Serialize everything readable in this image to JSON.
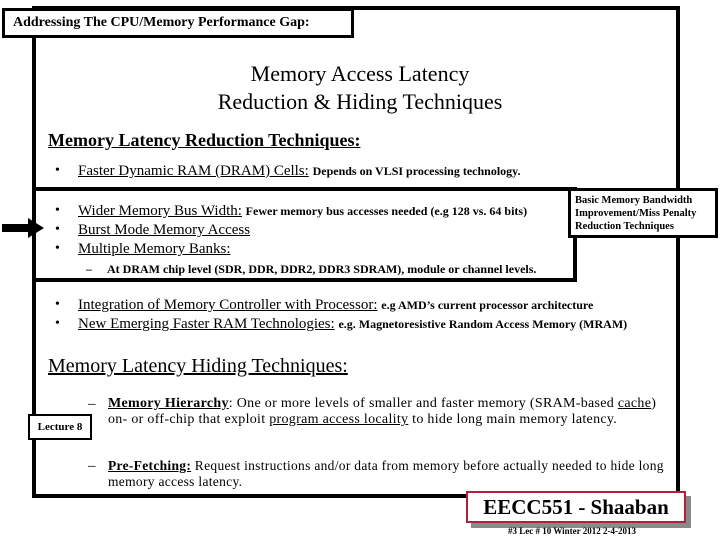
{
  "header": {
    "section_label": "Addressing The CPU/Memory Performance Gap:"
  },
  "title": {
    "line1": "Memory Access Latency",
    "line2": "Reduction & Hiding Techniques"
  },
  "reduction": {
    "heading": "Memory Latency Reduction Techniques:",
    "items": [
      {
        "bullet": "•",
        "label": "Faster Dynamic RAM (DRAM) Cells:",
        "note": "Depends on VLSI processing technology."
      },
      {
        "bullet": "•",
        "label": "Wider Memory Bus Width:",
        "note": "Fewer memory bus accesses needed  (e.g 128 vs. 64 bits)"
      },
      {
        "bullet": "•",
        "label": "Burst Mode Memory Access",
        "note": ""
      },
      {
        "bullet": "•",
        "label": "Multiple Memory Banks:",
        "note": ""
      },
      {
        "bullet": "•",
        "label": "Integration of Memory Controller with Processor:",
        "note": "e.g AMD’s current processor architecture"
      },
      {
        "bullet": "•",
        "label": "New Emerging Faster RAM Technologies:",
        "note": "e.g. Magnetoresistive Random Access Memory (MRAM)"
      }
    ],
    "sub_item": {
      "dash": "–",
      "text": "At DRAM chip level (SDR, DDR, DDR2, DDR3  SDRAM), module or channel levels."
    },
    "callout": "Basic Memory Bandwidth Improvement/Miss Penalty Reduction Techniques"
  },
  "hiding": {
    "heading": "Memory Latency Hiding Techniques:",
    "lecture_tag": "Lecture 8",
    "items": [
      {
        "dash": "–",
        "label": "Memory Hierarchy",
        "text_a": ": One or more levels of smaller and faster memory (SRAM-based ",
        "cache": "cache",
        "text_b": ") on- or off-chip that exploit ",
        "locality": "program access locality",
        "text_c": " to hide long main memory latency."
      },
      {
        "dash": "–",
        "label": "Pre-Fetching:",
        "text": "  Request instructions and/or data from memory before actually needed to hide long memory access latency."
      }
    ]
  },
  "footer": {
    "brand": "EECC551 - Shaaban",
    "info": "#3   Lec # 10 Winter 2012  2-4-2013"
  },
  "colors": {
    "brand_border": "#b3203f",
    "shadow": "#8a8a8a"
  }
}
